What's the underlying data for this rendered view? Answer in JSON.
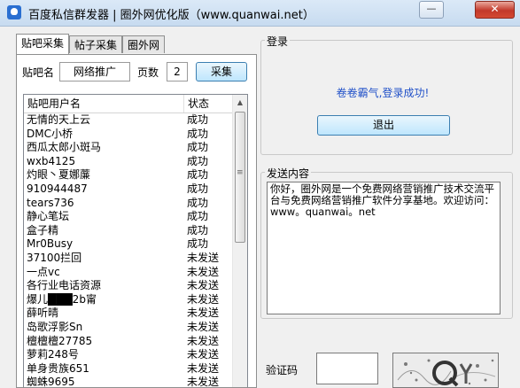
{
  "window": {
    "title": "百度私信群发器 | 圈外网优化版（www.quanwai.net）",
    "minimize_label": "—",
    "close_label": "✕"
  },
  "tabs": [
    {
      "label": "贴吧采集",
      "active": true
    },
    {
      "label": "帖子采集",
      "active": false
    },
    {
      "label": "圈外网",
      "active": false
    }
  ],
  "collect": {
    "tieba_label": "贴吧名",
    "tieba_value": "网络推广",
    "pages_label": "页数",
    "pages_value": "2",
    "collect_button": "采集"
  },
  "user_list": {
    "columns": [
      "贴吧用户名",
      "状态"
    ],
    "rows": [
      {
        "name": "无情的天上云",
        "status": "成功"
      },
      {
        "name": "DMC小桥",
        "status": "成功"
      },
      {
        "name": "西瓜太郎小斑马",
        "status": "成功"
      },
      {
        "name": "wxb4125",
        "status": "成功"
      },
      {
        "name": "灼眼丶夏娜薕",
        "status": "成功"
      },
      {
        "name": "910944487",
        "status": "成功"
      },
      {
        "name": "tears736",
        "status": "成功"
      },
      {
        "name": "静心笔坛",
        "status": "成功"
      },
      {
        "name": "盒子精",
        "status": "成功"
      },
      {
        "name": "Mr0Busy",
        "status": "成功"
      },
      {
        "name": "37100拦回",
        "status": "未发送"
      },
      {
        "name": "一点vc",
        "status": "未发送"
      },
      {
        "name": "各行业电话资源",
        "status": "未发送"
      },
      {
        "name": "爆儿███2b甯",
        "status": "未发送"
      },
      {
        "name": "薛听晴",
        "status": "未发送"
      },
      {
        "name": "岛歌浮影Sn",
        "status": "未发送"
      },
      {
        "name": "檀檀檀27785",
        "status": "未发送"
      },
      {
        "name": "萝莉248号",
        "status": "未发送"
      },
      {
        "name": "单身贵族651",
        "status": "未发送"
      },
      {
        "name": "蜘蛛9695",
        "status": "未发送"
      }
    ]
  },
  "login": {
    "legend": "登录",
    "message": "卷卷霸气,登录成功!",
    "logout_button": "退出"
  },
  "send": {
    "legend": "发送内容",
    "content": "你好，圈外网是一个免费网络营销推广技术交流平台与免费网络营销推广软件分享基地。欢迎访问：www。quanwai。net"
  },
  "captcha": {
    "label": "验证码",
    "input_value": ""
  },
  "colors": {
    "accent_blue": "#2050c8",
    "button_border": "#3c7fb1",
    "close_red": "#c2382a"
  }
}
